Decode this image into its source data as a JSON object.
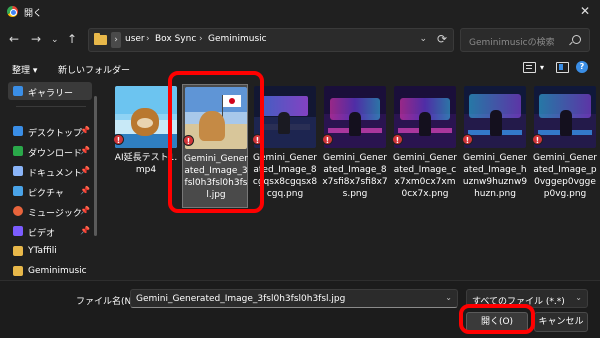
{
  "window": {
    "title": "開く",
    "close_glyph": "✕"
  },
  "nav": {
    "back": "←",
    "forward": "→",
    "dropdown": "⌄",
    "up": "↑",
    "crumb_sep": "›",
    "breadcrumb": [
      "user",
      "Box Sync",
      "Geminimusic"
    ],
    "address_dropdown": "⌄",
    "refresh": "⟳",
    "search_placeholder": "Geminimusicの検索"
  },
  "toolbar": {
    "organize": "整理 ▾",
    "new_folder": "新しいフォルダー",
    "view_dd": "▾"
  },
  "sidebar": {
    "items": [
      {
        "label": "ギャラリー",
        "icon": "gallery-icon",
        "color": "#3a8ee6",
        "pinned": false
      },
      {
        "label": "デスクトップ",
        "icon": "desktop-icon",
        "color": "#3a8ee6",
        "pinned": true
      },
      {
        "label": "ダウンロード",
        "icon": "download-icon",
        "color": "#2aa84a",
        "pinned": true
      },
      {
        "label": "ドキュメント",
        "icon": "document-icon",
        "color": "#8ab4f8",
        "pinned": true
      },
      {
        "label": "ピクチャ",
        "icon": "pictures-icon",
        "color": "#4aa3e8",
        "pinned": true
      },
      {
        "label": "ミュージック",
        "icon": "music-icon",
        "color": "#e8643c",
        "pinned": true
      },
      {
        "label": "ビデオ",
        "icon": "video-icon",
        "color": "#7b5cff",
        "pinned": true
      },
      {
        "label": "YTaffili",
        "icon": "folder-icon",
        "color": "#e8b84a",
        "pinned": false
      },
      {
        "label": "Geminimusic",
        "icon": "folder-icon",
        "color": "#e8b84a",
        "pinned": false
      }
    ],
    "pin_glyph": "📌"
  },
  "files": [
    {
      "name": "AI延長テスト1.mp4",
      "thumb": "dog"
    },
    {
      "name": "Gemini_Generated_Image_3fsl0h3fsl0h3fsl.jpg",
      "thumb": "beach"
    },
    {
      "name": "Gemini_Generated_Image_8cgqsx8cgqsx8cgq.png",
      "thumb": "studio"
    },
    {
      "name": "Gemini_Generated_Image_8x7sfi8x7sfi8x7s.png",
      "thumb": "neon"
    },
    {
      "name": "Gemini_Generated_Image_cx7xm0cx7xm0cx7x.png",
      "thumb": "neon"
    },
    {
      "name": "Gemini_Generated_Image_huznw9huznw9huzn.png",
      "thumb": "neon2"
    },
    {
      "name": "Gemini_Generated_Image_p0vggep0vggep0vg.png",
      "thumb": "neon2"
    }
  ],
  "error_badge": "!",
  "bottom": {
    "filename_label": "ファイル名(N):",
    "filename_value": "Gemini_Generated_Image_3fsl0h3fsl0h3fsl.jpg",
    "filetype_value": "すべてのファイル (*.*)",
    "dropdown": "⌄",
    "open_label": "開く(O)",
    "cancel_label": "キャンセル"
  },
  "accent_color": "#3a8ee6",
  "highlight_color": "#ff0000"
}
